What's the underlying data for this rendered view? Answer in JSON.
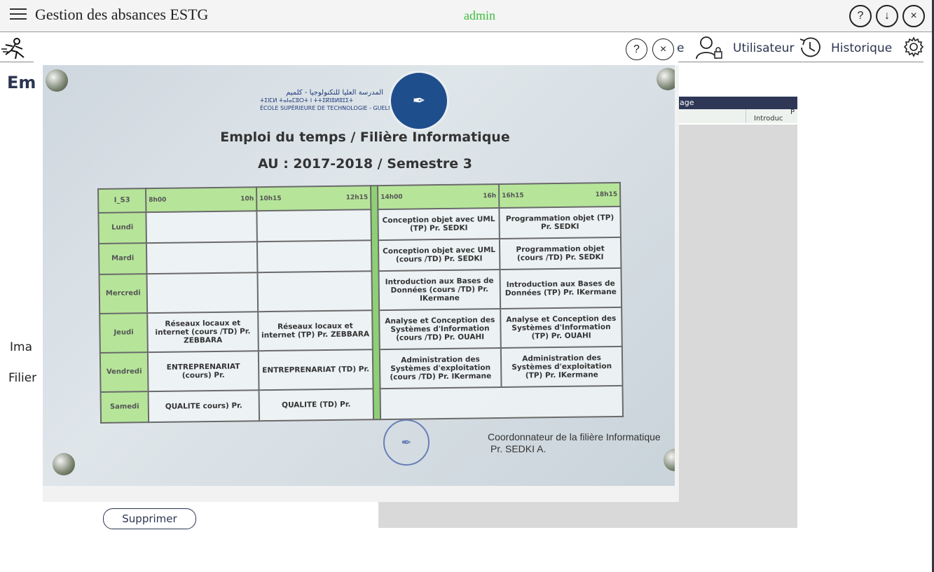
{
  "titlebar": {
    "title": "Gestion des absances ESTG",
    "user": "admin",
    "help_glyph": "?",
    "download_glyph": "↓",
    "close_glyph": "×"
  },
  "toolbar": {
    "partial_label": "e",
    "user_label": "Utilisateur",
    "history_label": "Historique",
    "help_glyph": "?",
    "close_glyph": "×"
  },
  "page": {
    "heading_partial": "Em",
    "label_image_partial": "Ima",
    "label_filiere_partial": "Filier",
    "table_header_partial": "age",
    "table_cell_partial": "Introduc",
    "table_cell_partial2": "P",
    "delete_button": "Supprimer"
  },
  "document": {
    "school_line1": "المدرسة العليا للتكنولوجيا - كلميم",
    "school_line2": "ⵜⵉⵏⵎⵍ ⵜⴰⵏⴰⵎⵓⵔⵜ ⵏ ⵜⵜⵉⴽⵏⵓⵍⵓⵊⵉⵜ",
    "school_line3": "ÉCOLE SUPÉRIEURE DE TECHNOLOGIE - GUELMIM",
    "title": "Emploi du temps / Filière  Informatique",
    "subtitle": "AU : 2017-2018 / Semestre 3",
    "headers": [
      "I_S3",
      "8h00",
      "10h",
      "10h15",
      "12h15",
      "14h00",
      "16h",
      "16h15",
      "18h15"
    ],
    "rows": [
      {
        "day": "Lundi",
        "c1": "",
        "c2": "",
        "c3": "Conception objet avec UML  (TP)  Pr.  SEDKI",
        "c4": "Programmation objet (TP)  Pr.  SEDKI"
      },
      {
        "day": "Mardi",
        "c1": "",
        "c2": "",
        "c3": "Conception objet avec UML (cours /TD)  Pr.  SEDKI",
        "c4": "Programmation objet (cours /TD)  Pr.  SEDKI"
      },
      {
        "day": "Mercredi",
        "c1": "",
        "c2": "",
        "c3": "Introduction aux Bases de Données (cours /TD)  Pr.  IKermane",
        "c4": "Introduction aux Bases de Données (TP)  Pr.  IKermane"
      },
      {
        "day": "Jeudi",
        "c1": "Réseaux locaux et internet (cours /TD)  Pr.  ZEBBARA",
        "c2": "Réseaux locaux et internet (TP)  Pr.  ZEBBARA",
        "c3": "Analyse et Conception des Systèmes d'Information (cours /TD)  Pr.  OUAHI",
        "c4": "Analyse et Conception des Systèmes d'Information (TP)  Pr.  OUAHI"
      },
      {
        "day": "Vendredi",
        "c1": "ENTREPRENARIAT (cours)  Pr.",
        "c2": "ENTREPRENARIAT (TD)  Pr.",
        "c3": "Administration des Systèmes d'exploitation (cours /TD)  Pr.  IKermane",
        "c4": "Administration des Systèmes d'exploitation (TP)  Pr.  IKermane"
      },
      {
        "day": "Samedi",
        "c1": "QUALITE cours)  Pr.",
        "c2": "QUALITE (TD)  Pr.",
        "c3": "",
        "c4": ""
      }
    ],
    "coordinator_line1": "Coordonnateur de la filière Informatique",
    "coordinator_line2": "Pr. SEDKI A."
  }
}
